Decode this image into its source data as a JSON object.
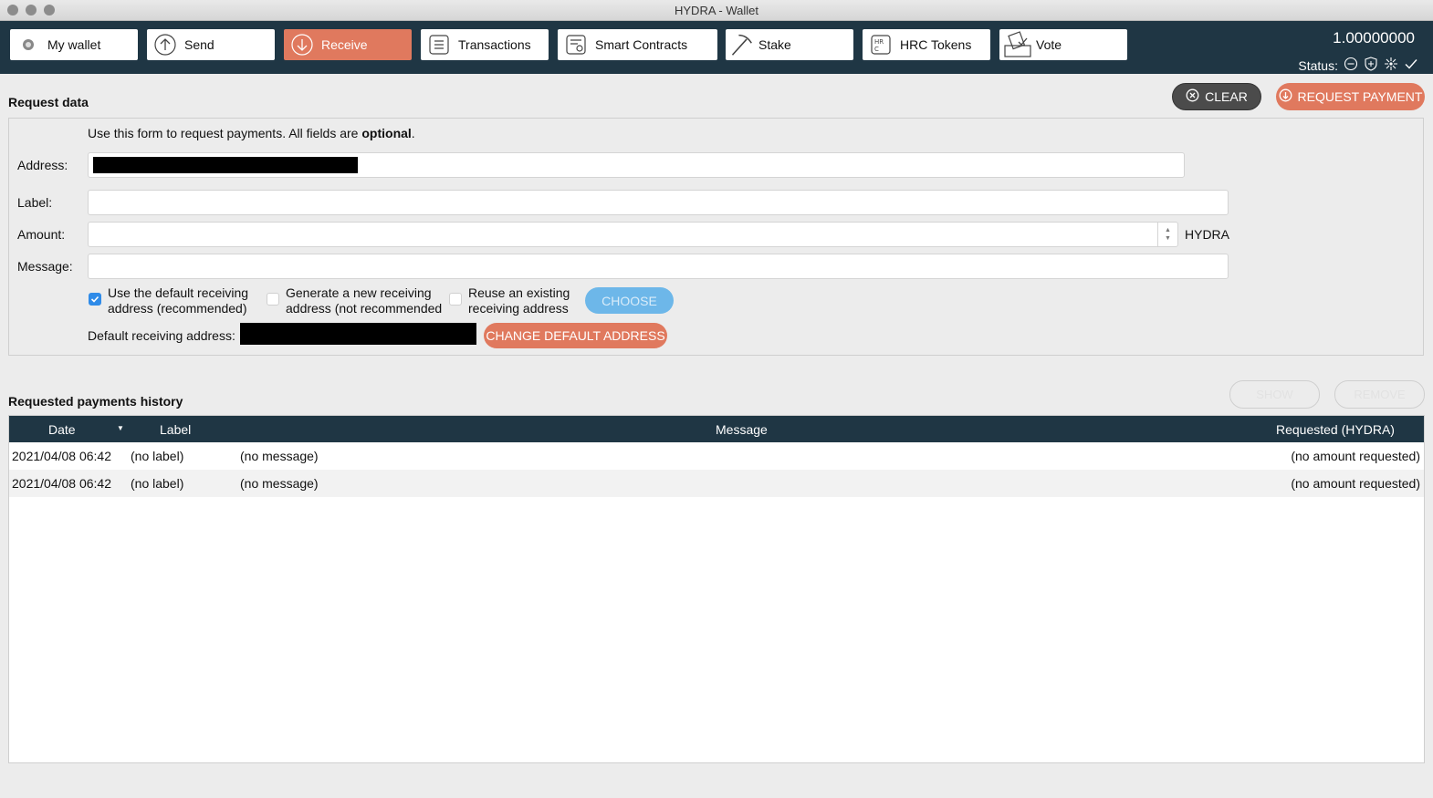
{
  "window": {
    "title": "HYDRA - Wallet"
  },
  "nav": {
    "tabs": [
      {
        "label": "My wallet",
        "icon": "wallet-icon"
      },
      {
        "label": "Send",
        "icon": "send-arrow-icon"
      },
      {
        "label": "Receive",
        "icon": "receive-arrow-icon",
        "active": true
      },
      {
        "label": "Transactions",
        "icon": "list-icon"
      },
      {
        "label": "Smart Contracts",
        "icon": "contract-icon"
      },
      {
        "label": "Stake",
        "icon": "pickaxe-icon"
      },
      {
        "label": "HRC Tokens",
        "icon": "token-icon"
      },
      {
        "label": "Vote",
        "icon": "ballot-icon"
      }
    ],
    "balance": "1.00000000",
    "status_label": "Status:"
  },
  "request": {
    "section_title": "Request data",
    "clear_label": "CLEAR",
    "request_label": "REQUEST PAYMENT",
    "intro_prefix": "Use this form to request payments. All fields are ",
    "intro_bold": "optional",
    "intro_suffix": ".",
    "address_label": "Address:",
    "label_label": "Label:",
    "amount_label": "Amount:",
    "message_label": "Message:",
    "amount_unit": "HYDRA",
    "options": [
      {
        "line1": "Use the default receiving",
        "line2": "address (recommended)",
        "checked": true
      },
      {
        "line1": "Generate a new receiving",
        "line2": "address (not recommended",
        "checked": false
      },
      {
        "line1": "Reuse an existing",
        "line2": "receiving address",
        "checked": false
      }
    ],
    "choose_label": "CHOOSE",
    "default_address_label": "Default receiving address:",
    "change_default_label": "CHANGE DEFAULT ADDRESS"
  },
  "history": {
    "section_title": "Requested payments history",
    "show_label": "SHOW",
    "remove_label": "REMOVE",
    "columns": {
      "date": "Date",
      "label": "Label",
      "message": "Message",
      "requested": "Requested (HYDRA)"
    },
    "rows": [
      {
        "date": "2021/04/08 06:42",
        "label": "(no label)",
        "message": "(no message)",
        "amount": "(no amount requested)"
      },
      {
        "date": "2021/04/08 06:42",
        "label": "(no label)",
        "message": "(no message)",
        "amount": "(no amount requested)"
      }
    ]
  },
  "colors": {
    "accent": "#e0795e",
    "nav_bg": "#1f3644",
    "check": "#2f8be8"
  }
}
